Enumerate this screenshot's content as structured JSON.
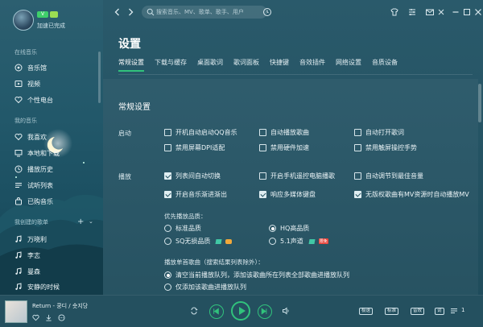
{
  "user": {
    "login_text": "加速已完成"
  },
  "sidebar": {
    "online_label": "在线音乐",
    "online_items": [
      {
        "label": "音乐馆",
        "icon": "music-hall-icon"
      },
      {
        "label": "视频",
        "icon": "video-icon"
      },
      {
        "label": "个性电台",
        "icon": "radio-heart-icon"
      }
    ],
    "my_label": "我的音乐",
    "my_items": [
      {
        "label": "我喜欢",
        "icon": "heart-icon"
      },
      {
        "label": "本地和下载",
        "icon": "computer-icon"
      },
      {
        "label": "播放历史",
        "icon": "history-icon"
      },
      {
        "label": "试听列表",
        "icon": "list-icon"
      },
      {
        "label": "已购音乐",
        "icon": "bag-icon"
      }
    ],
    "created_label": "我创建的歌单",
    "playlists": [
      {
        "label": "万晓利",
        "icon": "playlist-icon"
      },
      {
        "label": "李志",
        "icon": "playlist-icon"
      },
      {
        "label": "曼森",
        "icon": "playlist-icon"
      },
      {
        "label": "安静的时候",
        "icon": "playlist-icon"
      }
    ]
  },
  "search": {
    "placeholder": "搜索音乐、MV、歌单、歌手、用户"
  },
  "settings": {
    "title": "设置",
    "tabs": [
      "常规设置",
      "下载与缓存",
      "桌面歌词",
      "歌词面板",
      "快捷键",
      "音效插件",
      "网络设置",
      "音质设备"
    ],
    "section_title": "常规设置",
    "startup_label": "启动",
    "startup_options": [
      {
        "label": "开机自动启动QQ音乐",
        "checked": false
      },
      {
        "label": "自动播放歌曲",
        "checked": false
      },
      {
        "label": "自动打开歌词",
        "checked": false
      },
      {
        "label": "禁用屏幕DPI适配",
        "checked": false
      },
      {
        "label": "禁用硬件加速",
        "checked": false
      },
      {
        "label": "禁用触屏操控手势",
        "checked": false
      }
    ],
    "play_label": "播放",
    "play_options": [
      {
        "label": "列表间自动切换",
        "checked": true
      },
      {
        "label": "开启手机遥控电脑播歌",
        "checked": false
      },
      {
        "label": "自动调节到最佳音量",
        "checked": false
      },
      {
        "label": "开启音乐渐进渐出",
        "checked": true
      },
      {
        "label": "响应多媒体键盘",
        "checked": true
      },
      {
        "label": "无版权歌曲有MV资源时自动播放MV",
        "checked": true
      }
    ],
    "quality_label": "优先播放品质：",
    "quality_options": [
      {
        "label": "标准品质",
        "checked": false
      },
      {
        "label": "HQ高品质",
        "checked": true
      },
      {
        "label": "SQ无损品质",
        "checked": false
      },
      {
        "label": "5.1声道",
        "checked": false
      }
    ],
    "hot_badge": "限免",
    "single_label": "播放单首歌曲（搜索结果列表除外）：",
    "single_options": [
      {
        "label": "清空当前播放队列，添加该歌曲所在列表全部歌曲进播放队列",
        "checked": true
      },
      {
        "label": "仅添加该歌曲进播放队列",
        "checked": false
      }
    ]
  },
  "player": {
    "song": "Return - 쿵디 / 숏지당",
    "tags": [
      "极速",
      "标准",
      "音效",
      "词"
    ],
    "list_count": "1"
  },
  "colors": {
    "accent": "#31c27c",
    "background": "#1f4e5d"
  }
}
